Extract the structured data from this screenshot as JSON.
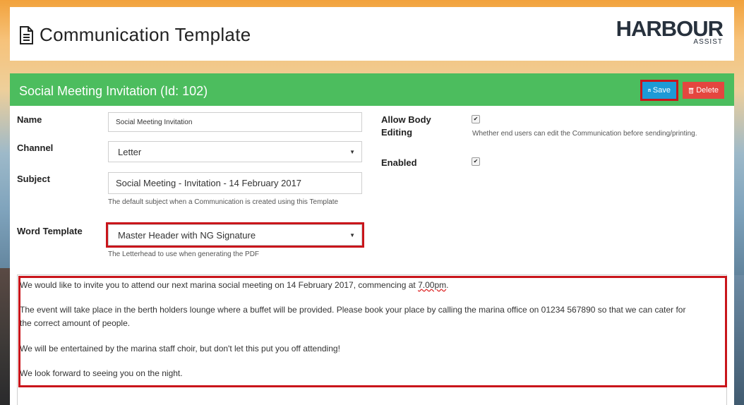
{
  "header": {
    "title": "Communication Template",
    "logo_word": "HARBOUR",
    "logo_sub": "ASSIST"
  },
  "panel": {
    "title": "Social Meeting Invitation (Id: 102)",
    "save_label": "Save",
    "delete_label": "Delete"
  },
  "form": {
    "name": {
      "label": "Name",
      "value": "Social Meeting Invitation"
    },
    "channel": {
      "label": "Channel",
      "value": "Letter"
    },
    "subject": {
      "label": "Subject",
      "value": "Social Meeting - Invitation - 14 February 2017",
      "help": "The default subject when a Communication is created using this Template"
    },
    "word_template": {
      "label": "Word Template",
      "value": "Master Header with NG Signature",
      "help": "The Letterhead to use when generating the PDF"
    },
    "allow_body_editing": {
      "label_line1": "Allow Body",
      "label_line2": "Editing",
      "checked": true,
      "help": "Whether end users can edit the Communication before sending/printing."
    },
    "enabled": {
      "label": "Enabled",
      "checked": true
    }
  },
  "body": {
    "p1_text": "We would like to invite you to attend our next marina social meeting on 14 February 2017, commencing at ",
    "p1_time": "7.00pm",
    "p1_end": ".",
    "p2_line1": "The event will take place in the berth holders lounge where a buffet will be provided.  Please book your place by calling the marina office on 01234 567890 so that we can cater for",
    "p2_line2": "the correct amount of people.",
    "p3": "We will be entertained by the marina staff choir, but don't let this put you off attending!",
    "p4": "We look forward to seeing you on the night."
  },
  "colors": {
    "panel_head": "#4cbd5e",
    "save_button": "#1d9ad6",
    "delete_button": "#e4463f",
    "highlight": "#c9151b"
  }
}
